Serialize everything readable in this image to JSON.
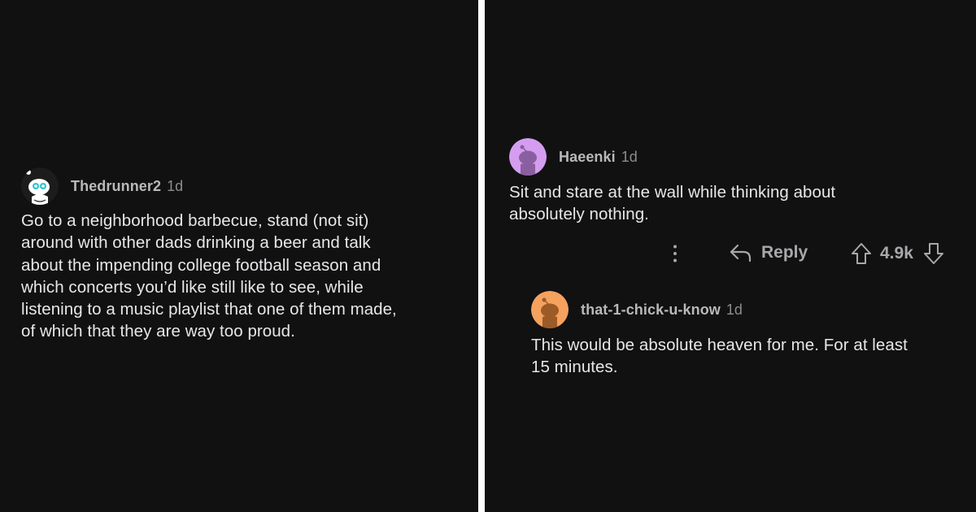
{
  "left_comment": {
    "username": "Thedrunner2",
    "age": "1d",
    "body": "Go to a neighborhood barbecue, stand (not sit)\naround with other dads drinking a beer and talk\nabout the impending college football season and\nwhich concerts you’d like still like to see, while\nlistening to a music playlist that one of them made,\nof which that they are way too proud.",
    "avatar_color": "#1a1a1a"
  },
  "right_comment": {
    "username": "Haeenki",
    "age": "1d",
    "body": "Sit and stare at the wall while thinking about\nabsolutely nothing.",
    "avatar_color": "#d59df0",
    "actions": {
      "more_icon": "more-vertical-icon",
      "reply_icon": "reply-arrow-icon",
      "reply_label": "Reply",
      "upvote_icon": "upvote-arrow-icon",
      "score": "4.9k",
      "downvote_icon": "downvote-arrow-icon"
    }
  },
  "reply_comment": {
    "username": "that-1-chick-u-know",
    "age": "1d",
    "body": "This would be absolute heaven for me. For at least\n15 minutes.",
    "avatar_color": "#f4a25e"
  },
  "colors": {
    "background": "#111112",
    "divider": "#ffffff",
    "text": "#e7e7e9",
    "muted": "#a8a8ab"
  }
}
